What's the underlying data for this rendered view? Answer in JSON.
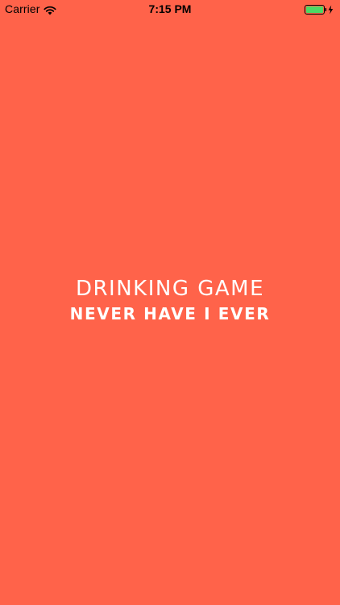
{
  "status_bar": {
    "carrier": "Carrier",
    "wifi_icon": "wifi-icon",
    "time": "7:15 PM",
    "battery_icon": "battery-charging-icon",
    "battery_color": "#4cd964"
  },
  "splash": {
    "background_color": "#ff634a",
    "title_line_1": "DRINKING GAME",
    "title_line_2": "NEVER HAVE I EVER"
  }
}
